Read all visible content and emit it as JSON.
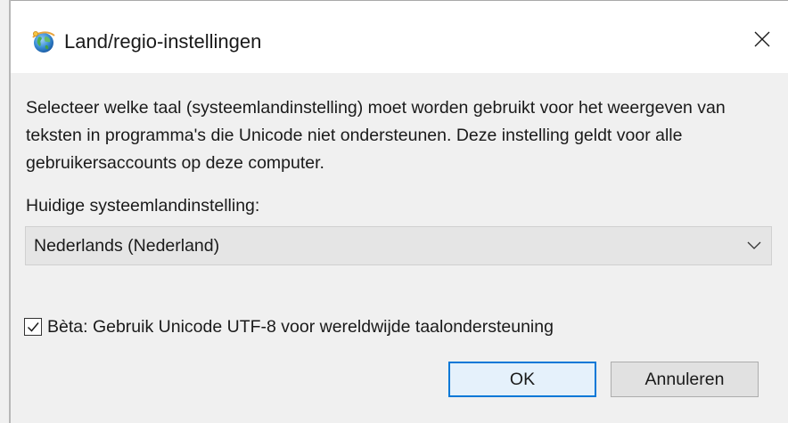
{
  "window": {
    "title": "Land/regio-instellingen",
    "icon": "globe-icon",
    "close_icon": "close-icon"
  },
  "dialog": {
    "description": "Selecteer welke taal (systeemlandinstelling) moet worden gebruikt voor het weergeven van teksten in programma's die Unicode niet ondersteunen. Deze instelling geldt voor alle gebruikersaccounts op deze computer.",
    "locale_label": "Huidige systeemlandinstelling:",
    "locale_select": {
      "selected": "Nederlands (Nederland)",
      "chevron_icon": "chevron-down-icon"
    },
    "utf8_checkbox": {
      "checked": true,
      "label": "Bèta: Gebruik Unicode UTF-8 voor wereldwijde taalondersteuning"
    },
    "buttons": {
      "ok_label": "OK",
      "cancel_label": "Annuleren"
    }
  },
  "colors": {
    "accent": "#0078d7",
    "dialog_bg": "#f0f0f0",
    "titlebar_bg": "#ffffff",
    "select_bg": "#e5e5e5",
    "button_bg": "#e1e1e1"
  }
}
